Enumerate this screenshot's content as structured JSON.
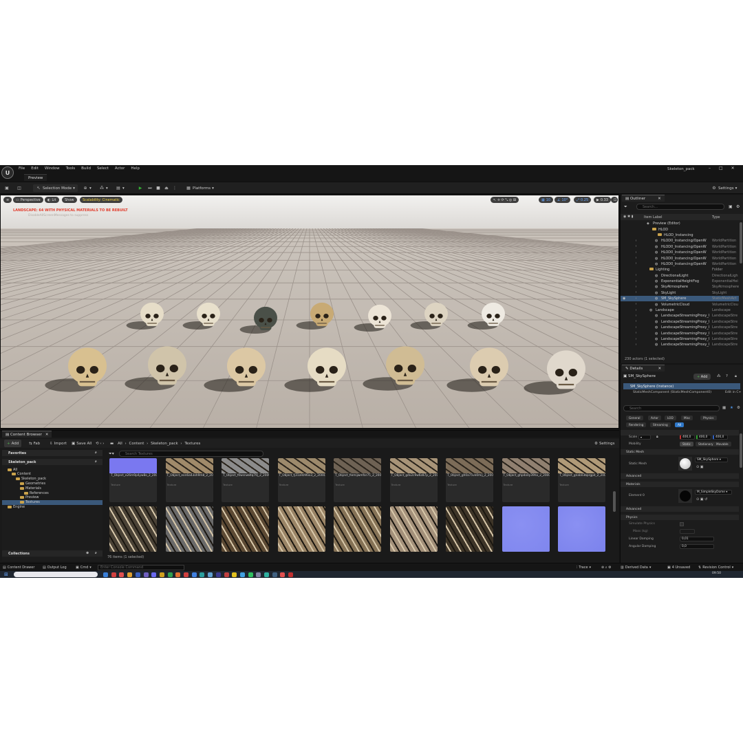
{
  "menubar": {
    "items": [
      "File",
      "Edit",
      "Window",
      "Tools",
      "Build",
      "Select",
      "Actor",
      "Help"
    ],
    "project": "Skeleton_pack",
    "level_tab": "Preview"
  },
  "toolbar": {
    "selection_mode": "Selection Mode",
    "platforms": "Platforms",
    "settings": "Settings"
  },
  "viewport": {
    "perspective": "Perspective",
    "lit": "Lit",
    "show": "Show",
    "scalability": "Scalability: Cinematic",
    "warning": "LANDSCAPE: 64  WITH PHYSICAL MATERIALS  TO BE REBUILT",
    "warning_sub": "DisableAllScreenMessages  to suppress",
    "grid_snap": "10",
    "rot_snap": "10°",
    "scale_snap": "0.25",
    "camera_speed": "0.33"
  },
  "outliner": {
    "tab": "Outliner",
    "search_placeholder": "Search...",
    "col_label": "Item Label",
    "col_type": "Type",
    "rows": [
      {
        "label": "Preview (Editor)",
        "type": "",
        "indent": 44,
        "kind": "world"
      },
      {
        "label": "HLOD",
        "type": "",
        "indent": 52,
        "kind": "folder"
      },
      {
        "label": "HLOD_Instancing",
        "type": "",
        "indent": 60,
        "kind": "folder"
      },
      {
        "label": "HLOD0_Instancing/OpenW",
        "type": "WorldPartition",
        "indent": 56,
        "kind": "actor"
      },
      {
        "label": "HLOD0_Instancing/OpenW",
        "type": "WorldPartition",
        "indent": 56,
        "kind": "actor"
      },
      {
        "label": "HLOD0_Instancing/OpenW",
        "type": "WorldPartition",
        "indent": 56,
        "kind": "actor"
      },
      {
        "label": "HLOD0_Instancing/OpenW",
        "type": "WorldPartition",
        "indent": 56,
        "kind": "actor"
      },
      {
        "label": "HLOD0_Instancing/OpenW",
        "type": "WorldPartition",
        "indent": 56,
        "kind": "actor"
      },
      {
        "label": "Lighting",
        "type": "Folder",
        "indent": 48,
        "kind": "folder"
      },
      {
        "label": "DirectionalLight",
        "type": "DirectionalLigh",
        "indent": 56,
        "kind": "actor"
      },
      {
        "label": "ExponentialHeightFog",
        "type": "ExponentialHei",
        "indent": 56,
        "kind": "actor"
      },
      {
        "label": "SkyAtmosphere",
        "type": "SkyAtmosphere",
        "indent": 56,
        "kind": "actor"
      },
      {
        "label": "SkyLight",
        "type": "SkyLight",
        "indent": 56,
        "kind": "actor"
      },
      {
        "label": "SM_SkySphere",
        "type": "StaticMeshAct",
        "indent": 56,
        "kind": "actor",
        "selected": true
      },
      {
        "label": "VolumetricCloud",
        "type": "VolumetricClou",
        "indent": 56,
        "kind": "actor"
      },
      {
        "label": "Landscape",
        "type": "Landscape",
        "indent": 48,
        "kind": "actor"
      },
      {
        "label": "LandscapeStreamingProxy_l",
        "type": "LandscapeStre",
        "indent": 56,
        "kind": "actor"
      },
      {
        "label": "LandscapeStreamingProxy_l",
        "type": "LandscapeStre",
        "indent": 56,
        "kind": "actor"
      },
      {
        "label": "LandscapeStreamingProxy_l",
        "type": "LandscapeStre",
        "indent": 56,
        "kind": "actor"
      },
      {
        "label": "LandscapeStreamingProxy_l",
        "type": "LandscapeStre",
        "indent": 56,
        "kind": "actor"
      },
      {
        "label": "LandscapeStreamingProxy_l",
        "type": "LandscapeStre",
        "indent": 56,
        "kind": "actor"
      },
      {
        "label": "LandscapeStreamingProxy_l",
        "type": "LandscapeStre",
        "indent": 56,
        "kind": "actor"
      }
    ],
    "footer": "230 actors (1 selected)"
  },
  "details": {
    "tab": "Details",
    "actor_name": "SM_SkySphere",
    "add_label": "Add",
    "instance_label": "SM_SkySphere (Instance)",
    "component_label": "StaticMeshComponent (StaticMeshComponent0)",
    "edit_label": "Edit in C+",
    "search_placeholder": "Search",
    "filter_chips": [
      "General",
      "Actor",
      "LOD",
      "Misc",
      "Physics",
      "Rendering",
      "Streaming",
      "All"
    ],
    "scale_label": "Scale",
    "scale_values": [
      "400,0",
      "400,0",
      "400,0"
    ],
    "mobility_label": "Mobility",
    "mobility_options": [
      "Static",
      "Stationary",
      "Movable"
    ],
    "sec_static_mesh": "Static Mesh",
    "static_mesh_label": "Static Mesh",
    "static_mesh_value": "SM_SkySphere",
    "sec_advanced": "Advanced",
    "sec_materials": "Materials",
    "element0_label": "Element 0",
    "element0_value": "M_SimpleSkyDome",
    "sec_advanced2": "Advanced",
    "sec_physics": "Physics",
    "simulate_physics": "Simulate Physics",
    "mass_kg": "Mass (kg)",
    "linear_damping": "Linear Damping",
    "linear_damping_value": "0,01",
    "angular_damping": "Angular Damping",
    "angular_damping_value": "0,0"
  },
  "content_browser": {
    "tab": "Content Browser",
    "add": "Add",
    "fab": "Fab",
    "import": "Import",
    "save_all": "Save All",
    "path": [
      "All",
      "Content",
      "Skeleton_pack",
      "Textures"
    ],
    "settings": "Settings",
    "search_placeholder": "Search Textures",
    "favorites": "Favorites",
    "project": "Skeleton_pack",
    "tree": [
      {
        "label": "All",
        "indent": 8
      },
      {
        "label": "Content",
        "indent": 14
      },
      {
        "label": "Skeleton_pack",
        "indent": 20
      },
      {
        "label": "Geometries",
        "indent": 26
      },
      {
        "label": "Materials",
        "indent": 26
      },
      {
        "label": "References",
        "indent": 32
      },
      {
        "label": "Preview",
        "indent": 26
      },
      {
        "label": "Textures",
        "indent": 26,
        "selected": true
      },
      {
        "label": "Engine",
        "indent": 8
      }
    ],
    "collections": "Collections",
    "assets": [
      {
        "name": "T_Object_e26m9p4yw8o_2_200000_Tex",
        "type": "Texture",
        "color": "#7a78f0"
      },
      {
        "name": "T_Object_eon6a43oh9m8_2_200027_Tex",
        "type": "Texture",
        "color": "#a08a6a"
      },
      {
        "name": "T_Object_f0wsnw8tq79j_2_200000_Tex",
        "type": "Texture",
        "color": "#8c8c8c"
      },
      {
        "name": "T_Object_fj31a9z96io3_2_200027_Tex",
        "type": "Texture",
        "color": "#9d8a6c"
      },
      {
        "name": "T_Object_fiemijwmfar75_2_200027_Tex",
        "type": "Texture",
        "color": "#6e6254"
      },
      {
        "name": "T_Object_gdv2c9w6z87p_2_200027_Tex",
        "type": "Texture",
        "color": "#a89478"
      },
      {
        "name": "T_Object_gh0a75ve0mij_2_200000_Tex",
        "type": "Texture",
        "color": "#7c6c58"
      },
      {
        "name": "T_Object_ghpdo0y39ha_2_200027_Tex",
        "type": "Texture",
        "color": "#908070"
      },
      {
        "name": "T_Object_gnab03bprgpd_2_200027_Tex",
        "type": "Texture",
        "color": "#b09a78"
      }
    ],
    "row2_colors": [
      "#4a4236",
      "#6a6a6a",
      "#5d4a34",
      "#9a8466",
      "#857256",
      "#a3907a",
      "#3e3528",
      "#7f86ee",
      "#7b82ec"
    ],
    "status": "76 items (1 selected)"
  },
  "statusbar": {
    "content_drawer": "Content Drawer",
    "output_log": "Output Log",
    "cmd": "Cmd",
    "console_placeholder": "Enter Console Command",
    "trace": "Trace",
    "derived_data": "Derived Data",
    "unsaved": "4 Unsaved",
    "revision": "Revision Control"
  },
  "taskbar": {
    "time": "09:50"
  }
}
